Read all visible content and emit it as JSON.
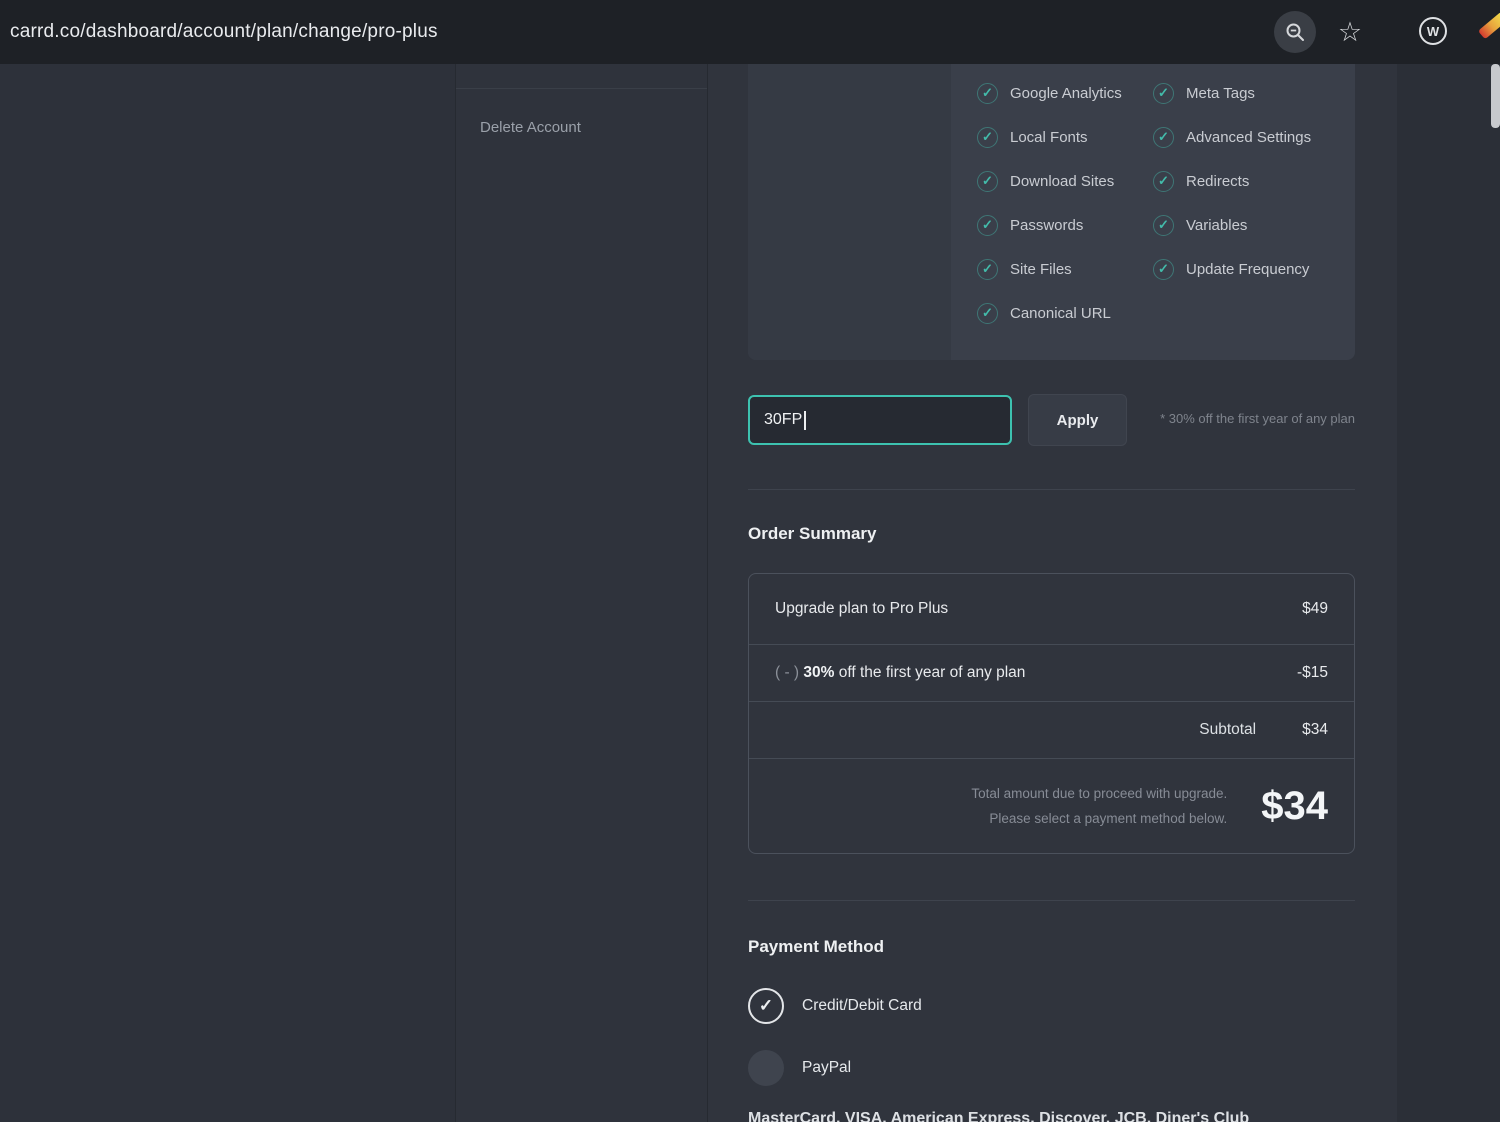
{
  "browser": {
    "url": "carrd.co/dashboard/account/plan/change/pro-plus",
    "icons": {
      "zoom": "zoom-indicator-icon",
      "star": "bookmark-star-icon",
      "extension_w": "w-extension-icon",
      "extension_color": "colorzilla-extension-icon"
    }
  },
  "glyphs": {
    "check": "✓",
    "star": "☆",
    "w": "W"
  },
  "sidebar": {
    "delete_account": "Delete Account"
  },
  "features": {
    "col1": [
      "Google Analytics",
      "Local Fonts",
      "Download Sites",
      "Passwords",
      "Site Files",
      "Canonical URL"
    ],
    "col2": [
      "Meta Tags",
      "Advanced Settings",
      "Redirects",
      "Variables",
      "Update Frequency"
    ]
  },
  "promo": {
    "code": "30FP",
    "apply_label": "Apply",
    "note": "* 30% off the first year of any plan"
  },
  "order_summary": {
    "title": "Order Summary",
    "row1": {
      "label": "Upgrade plan to Pro Plus",
      "amount": "$49"
    },
    "row2": {
      "prefix": "( - ) ",
      "bold": "30%",
      "label": " off the first year of any plan",
      "amount": "-$15"
    },
    "row3": {
      "label": "Subtotal",
      "amount": "$34"
    },
    "total_note_line1": "Total amount due to proceed with upgrade.",
    "total_note_line2": "Please select a payment method below.",
    "total": "$34"
  },
  "payment": {
    "title": "Payment Method",
    "options": [
      {
        "label": "Credit/Debit Card",
        "selected": true
      },
      {
        "label": "PayPal",
        "selected": false
      }
    ],
    "cards_line": "MasterCard, VISA, American Express, Discover, JCB, Diner's Club"
  },
  "colors": {
    "accent_teal": "#3dc2b0",
    "panel_bg": "#3a3f4a",
    "page_bg": "#30343d",
    "toolbar_bg": "#1e2126"
  }
}
